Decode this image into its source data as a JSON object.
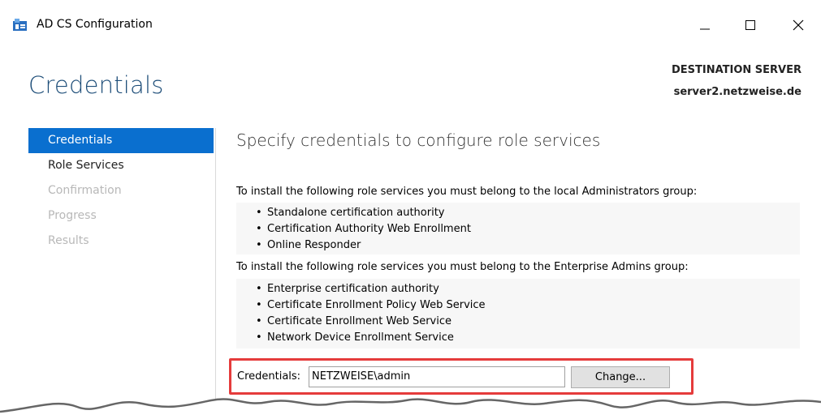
{
  "window": {
    "title": "AD CS Configuration",
    "controls": {
      "minimize_icon": "minimize-icon",
      "maximize_icon": "maximize-icon",
      "close_icon": "close-icon"
    }
  },
  "header": {
    "page_title": "Credentials",
    "destination_label": "DESTINATION SERVER",
    "destination_server": "server2.netzweise.de"
  },
  "sidebar": {
    "items": [
      {
        "label": "Credentials",
        "state": "active"
      },
      {
        "label": "Role Services",
        "state": "enabled"
      },
      {
        "label": "Confirmation",
        "state": "disabled"
      },
      {
        "label": "Progress",
        "state": "disabled"
      },
      {
        "label": "Results",
        "state": "disabled"
      }
    ]
  },
  "main": {
    "heading": "Specify credentials to configure role services",
    "local_admins_text": "To install the following role services you must belong to the local Administrators group:",
    "local_admins_services": [
      "Standalone certification authority",
      "Certification Authority Web Enrollment",
      "Online Responder"
    ],
    "enterprise_admins_text": "To install the following role services you must belong to the Enterprise Admins group:",
    "enterprise_admins_services": [
      "Enterprise certification authority",
      "Certificate Enrollment Policy Web Service",
      "Certificate Enrollment Web Service",
      "Network Device Enrollment Service"
    ],
    "credentials": {
      "label": "Credentials:",
      "value": "NETZWEISE\\admin",
      "change_button": "Change..."
    }
  },
  "colors": {
    "accent": "#0a6fcf",
    "title_blue": "#1e4e79",
    "highlight_frame": "#e53b3b"
  }
}
